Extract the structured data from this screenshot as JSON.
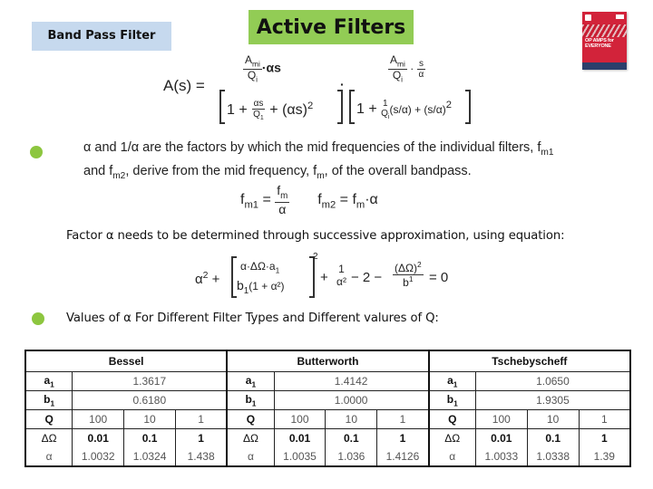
{
  "slide": {
    "section_label": "Band Pass Filter",
    "title": "Active Filters",
    "book_cover": {
      "icon": "book-cover-image",
      "title_line1": "OP AMPS for",
      "title_line2": "EVERYONE"
    },
    "transfer_function": {
      "lhs": "A(s) =",
      "num1_top": "A",
      "num1_top_sub": "mi",
      "num1_bottom": "Q",
      "num1_bottom_sub": "i",
      "num1_tail": "·αs",
      "num2_tail": "·",
      "num2_s": "s",
      "num2_alpha": "α",
      "den1": "1 + ",
      "den1_frac_num": "αs",
      "den1_frac_den": "Q",
      "den1_frac_den_sub": "1",
      "den1_tail": " + (αs)",
      "sq": "2",
      "dot": "·",
      "den2": "1 + ",
      "den2_one": "1",
      "den2_q": "Q",
      "den2_q_sub": "i",
      "den2_mid": "(s/α) + (s/α)",
      "den2_sq": "2"
    },
    "bullet1": {
      "line1_a": "α and 1/α are the factors by which the mid frequencies of the individual filters, f",
      "line1_sub": "m1",
      "line2_a": "and f",
      "line2_sub1": "m2",
      "line2_b": ", derive from the mid frequency, f",
      "line2_sub2": "m",
      "line2_c": ", of the overall bandpass."
    },
    "fm_equation": {
      "f": "f",
      "m1": "m1",
      "eq": " = ",
      "fm_num": "f",
      "fm_num_sub": "m",
      "alpha": "α",
      "m2": "m2",
      "rhs2_f": "f",
      "rhs2_sub": "m",
      "rhs2_tail": "·α"
    },
    "factor_text": "Factor α needs to be determined through successive approximation, using equation:",
    "alpha_equation": {
      "a2": "α",
      "sq": "2",
      "plus": " + ",
      "frac_num": "α·ΔΩ·a",
      "frac_num_sub": "1",
      "frac_den_b": "b",
      "frac_den_sub": "1",
      "frac_den_tail": "(1 + α²)",
      "outer_sq": "2",
      "one": "1",
      "alpha_sq": "α²",
      "minus2": " − 2 − ",
      "dw": "(ΔΩ)",
      "dw_sq": "2",
      "b1": "b",
      "b1_sup": "1",
      "eq0": " = 0"
    },
    "bullet2": "Values of α For Different Filter Types and Different valures of Q:",
    "table": {
      "groups": [
        {
          "name": "Bessel",
          "a1": "1.3617",
          "b1": "0.6180",
          "Q": [
            "100",
            "10",
            "1"
          ],
          "dOmega": [
            "0.01",
            "0.1",
            "1"
          ],
          "alpha": [
            "1.0032",
            "1.0324",
            "1.438"
          ]
        },
        {
          "name": "Butterworth",
          "a1": "1.4142",
          "b1": "1.0000",
          "Q": [
            "100",
            "10",
            "1"
          ],
          "dOmega": [
            "0.01",
            "0.1",
            "1"
          ],
          "alpha": [
            "1.0035",
            "1.036",
            "1.4126"
          ]
        },
        {
          "name": "Tschebyscheff",
          "a1": "1.0650",
          "b1": "1.9305",
          "Q": [
            "100",
            "10",
            "1"
          ],
          "dOmega": [
            "0.01",
            "0.1",
            "1"
          ],
          "alpha": [
            "1.0033",
            "1.0338",
            "1.39"
          ]
        }
      ],
      "labels": {
        "a": "a",
        "a_sub": "1",
        "b": "b",
        "b_sub": "1",
        "q": "Q",
        "dw": "ΔΩ",
        "alpha": "α"
      }
    },
    "colors": {
      "bullet": "#8dc63f",
      "title_bg": "#92cc55",
      "section_bg": "#c6d9ee"
    }
  }
}
